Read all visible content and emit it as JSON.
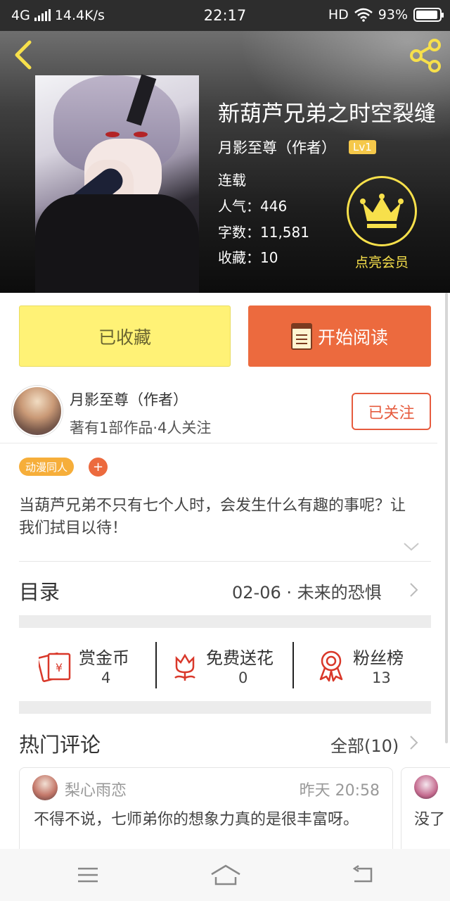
{
  "status_bar": {
    "network": "4G",
    "speed": "14.4K/s",
    "time": "22:17",
    "hd": "HD",
    "battery": "93%",
    "battery_level": 0.93
  },
  "header": {
    "book_title": "新葫芦兄弟之时空裂缝",
    "author": "月影至尊（作者）",
    "level": "Lv1",
    "status": "连载",
    "popularity": "人气：446",
    "word_count": "字数：11,581",
    "favorites": "收藏：10",
    "vip_label": "点亮会员"
  },
  "actions": {
    "favorited_label": "已收藏",
    "read_label": "开始阅读"
  },
  "author_card": {
    "name": "月影至尊（作者）",
    "stats": "著有1部作品·4人关注",
    "follow_label": "已关注"
  },
  "tags": [
    "动漫同人"
  ],
  "tag_add": "+",
  "description": "当葫芦兄弟不只有七个人时，会发生什么有趣的事呢？让我们拭目以待！",
  "toc": {
    "label": "目录",
    "latest": "02-06 · 未来的恐惧"
  },
  "stats": [
    {
      "label": "赏金币",
      "value": "4",
      "icon": "red-envelope-icon"
    },
    {
      "label": "免费送花",
      "value": "0",
      "icon": "flower-icon"
    },
    {
      "label": "粉丝榜",
      "value": "13",
      "icon": "medal-icon"
    }
  ],
  "comments_section": {
    "title": "热门评论",
    "all_label": "全部(10)",
    "comments": [
      {
        "user": "梨心雨恋",
        "time": "昨天 20:58",
        "text": "不得不说，七师弟你的想象力真的是很丰富呀。"
      },
      {
        "user": "",
        "time": "",
        "text": "没了"
      }
    ]
  },
  "colors": {
    "accent_orange": "#ec6a3e",
    "favorite_yellow": "#fff276",
    "vip_gold": "#f7e04b",
    "tag_orange": "#f6ae3a"
  }
}
